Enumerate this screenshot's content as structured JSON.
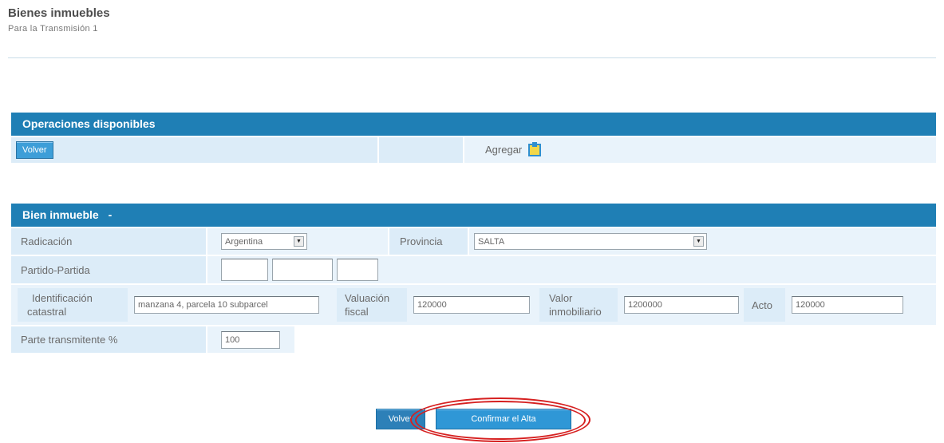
{
  "page": {
    "title": "Bienes inmuebles",
    "subtitle": "Para la  Transmisión  1"
  },
  "operaciones": {
    "header": "Operaciones disponibles",
    "volver_label": "Volver",
    "agregar_label": "Agregar"
  },
  "bien": {
    "header": "Bien inmueble",
    "header_suffix": "-",
    "radicacion_label": "Radicación",
    "radicacion_value": "Argentina",
    "provincia_label": "Provincia",
    "provincia_value": "SALTA",
    "partido_label": "Partido-Partida",
    "partido_values": [
      "",
      "",
      ""
    ],
    "identificacion_label_line1": "Identificación",
    "identificacion_label_line2": "catastral",
    "identificacion_value": "manzana 4, parcela 10 subparcel",
    "valuacion_label_line1": "Valuación",
    "valuacion_label_line2": "fiscal",
    "valuacion_value": "120000",
    "valor_label_line1": "Valor",
    "valor_label_line2": "inmobiliario",
    "valor_value": "1200000",
    "acto_label": "Acto",
    "acto_value": "120000",
    "parte_label": "Parte transmitente %",
    "parte_value": "100"
  },
  "footer": {
    "volver_label": "Volver",
    "confirmar_label": "Confirmar el Alta"
  },
  "colors": {
    "header_blue": "#1f7fb5",
    "row_light": "#e9f3fb",
    "button_blue": "#2f97d6",
    "annotation_red": "#d62020"
  },
  "icons": {
    "agregar": "add-document-icon",
    "dropdown": "chevron-down-icon"
  }
}
